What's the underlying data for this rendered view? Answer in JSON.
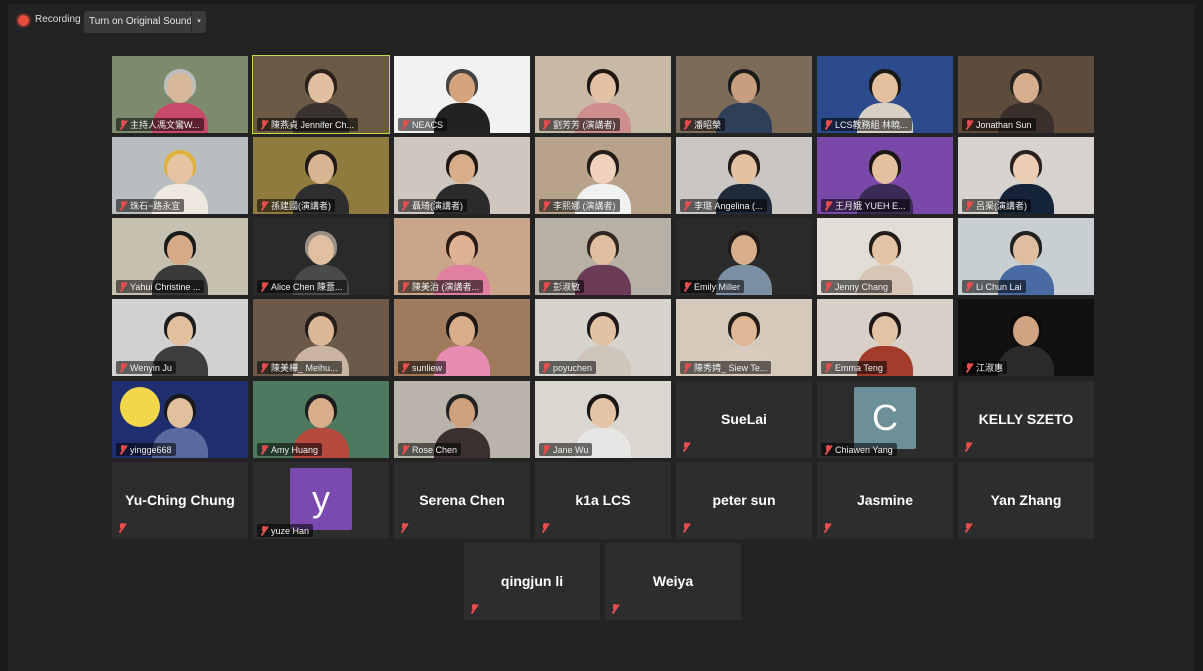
{
  "topbar": {
    "recording_label": "Recording",
    "original_sound_label": "Turn on Original Sound",
    "caret": "▾"
  },
  "video_tiles": [
    {
      "name": "主持人馮文鸞W...",
      "bg": "#7c8b6e",
      "skin": "#d9b79a",
      "hair": "#bdbdbd",
      "shirt": "#c94a68"
    },
    {
      "name": "陳燕貞 Jennifer Ch...",
      "bg": "#6b5a46",
      "skin": "#e0bfa0",
      "hair": "#2b201b",
      "shirt": "#3a3330",
      "speaking": true
    },
    {
      "name": "NEACS",
      "bg": "#f2f2f2",
      "skin": "#d3a47e",
      "hair": "#444",
      "shirt": "#222"
    },
    {
      "name": "劉芳芳 (演講者)",
      "bg": "#c8b9a6",
      "skin": "#e3c1a4",
      "hair": "#1d1712",
      "shirt": "#cf8e8e"
    },
    {
      "name": "潘昭榮",
      "bg": "#7d6b5a",
      "skin": "#c79f80",
      "hair": "#1b1b1b",
      "shirt": "#2f3f5a"
    },
    {
      "name": "LCS教務組 林曉...",
      "bg": "#2c4b8c",
      "skin": "#e2c09e",
      "hair": "#181818",
      "shirt": "#d8d0c4"
    },
    {
      "name": "Jonathan Sun",
      "bg": "#5d4b3c",
      "skin": "#d6ae8d",
      "hair": "#222",
      "shirt": "#3b2f2b"
    },
    {
      "name": "珠石~路永宜",
      "bg": "#b8bdbf",
      "skin": "#e6c4a3",
      "hair": "#e0b23b",
      "shirt": "#efe8df"
    },
    {
      "name": "孫建國(演講者)",
      "bg": "#8f7b3e",
      "skin": "#d9b493",
      "hair": "#1f1a16",
      "shirt": "#2e2e2e"
    },
    {
      "name": "聶琦(演講者)",
      "bg": "#cfc7be",
      "skin": "#d7ad8a",
      "hair": "#1d1814",
      "shirt": "#2b2b2b"
    },
    {
      "name": "李熙娜 (演講者)",
      "bg": "#b7a38c",
      "skin": "#f0d2bc",
      "hair": "#231c18",
      "shirt": "#f1f1f1"
    },
    {
      "name": "李璐 Angelina (...",
      "bg": "#c9c6c3",
      "skin": "#e3c1a1",
      "hair": "#251d18",
      "shirt": "#1f2b3a"
    },
    {
      "name": "王月娥 YUEH E...",
      "bg": "#7a48a8",
      "skin": "#e4c09f",
      "hair": "#1b1715",
      "shirt": "#3a2a55"
    },
    {
      "name": "呂渠(演講者)",
      "bg": "#d6d2cd",
      "skin": "#eacdb2",
      "hair": "#2a211c",
      "shirt": "#16243a"
    },
    {
      "name": "Yahui Christine ...",
      "bg": "#c6c0b0",
      "skin": "#d5aa87",
      "hair": "#191919",
      "shirt": "#3a3a3a"
    },
    {
      "name": "Alice Chen 陳薏...",
      "bg": "#2a2a2a",
      "skin": "#e1c0a2",
      "hair": "#9a8f86",
      "shirt": "#4a4a4a"
    },
    {
      "name": "陳美治 (演講者...",
      "bg": "#caa58a",
      "skin": "#deb395",
      "hair": "#2a1c15",
      "shirt": "#e07fa0"
    },
    {
      "name": "彭淑敏",
      "bg": "#b7b0a5",
      "skin": "#e0bea0",
      "hair": "#312620",
      "shirt": "#6b3b58"
    },
    {
      "name": "Emily Miller",
      "bg": "#2a2a2a",
      "skin": "#d7ad8a",
      "hair": "#1f1a17",
      "shirt": "#7b8fa3"
    },
    {
      "name": "Jenny Chang",
      "bg": "#e2ddd6",
      "skin": "#e2c3a6",
      "hair": "#241c17",
      "shirt": "#d7c6b6"
    },
    {
      "name": "Li Chun Lai",
      "bg": "#c7cfd2",
      "skin": "#dfbda0",
      "hair": "#20201f",
      "shirt": "#4a6aa3"
    },
    {
      "name": "Wenyin Ju",
      "bg": "#d1d1d1",
      "skin": "#e1bf9f",
      "hair": "#1c1c1c",
      "shirt": "#3d3d3d"
    },
    {
      "name": "陳美樺_ Meihu...",
      "bg": "#6b5a4c",
      "skin": "#dbb797",
      "hair": "#241d19",
      "shirt": "#c9b5a2"
    },
    {
      "name": "sunliew",
      "bg": "#a07a5c",
      "skin": "#d8ae8c",
      "hair": "#1e1713",
      "shirt": "#e58cb0"
    },
    {
      "name": "poyuchen",
      "bg": "#d7d3cd",
      "skin": "#e1c2a5",
      "hair": "#20191a",
      "shirt": "#d0c5bb"
    },
    {
      "name": "陳秀娉_ Siew Te...",
      "bg": "#d5c9bb",
      "skin": "#deb896",
      "hair": "#221b16",
      "shirt": "#d9cbbd"
    },
    {
      "name": "Emma Teng",
      "bg": "#d8cfc6",
      "skin": "#e3c3a6",
      "hair": "#1f1815",
      "shirt": "#a33c2b"
    },
    {
      "name": "江淑惠",
      "bg": "#111",
      "skin": "#d0a483",
      "hair": "#0e0b09",
      "shirt": "#2b2b2b"
    },
    {
      "name": "yingge668",
      "bg": "#1f2e6e",
      "skin": "#e1c0a0",
      "hair": "#1a1a1a",
      "shirt": "#586a9e",
      "moon": true
    },
    {
      "name": "Amy Huang",
      "bg": "#4d7a5e",
      "skin": "#d8ad8a",
      "hair": "#1c1c1c",
      "shirt": "#b74a3e"
    },
    {
      "name": "Rose Chen",
      "bg": "#b9b3a9",
      "skin": "#cfa17d",
      "hair": "#222",
      "shirt": "#3b2f2f"
    },
    {
      "name": "Jane Wu",
      "bg": "#dad7d1",
      "skin": "#e4c4a7",
      "hair": "#1b1614",
      "shirt": "#e8e6e4"
    }
  ],
  "text_tiles": [
    {
      "name": "SueLai"
    },
    {
      "name": "KELLY SZETO"
    },
    {
      "name": "Yu-Ching Chung"
    },
    {
      "name": "Serena Chen"
    },
    {
      "name": "k1a LCS"
    },
    {
      "name": "peter sun"
    },
    {
      "name": "Jasmine"
    },
    {
      "name": "Yan Zhang"
    },
    {
      "name": "qingjun li"
    },
    {
      "name": "Weiya"
    }
  ],
  "avatar_tiles": [
    {
      "letter": "C",
      "name": "Chiawen Yang",
      "color": "#6d8f98"
    },
    {
      "letter": "y",
      "name": "yuze Han",
      "color": "#7b4ab0"
    }
  ]
}
